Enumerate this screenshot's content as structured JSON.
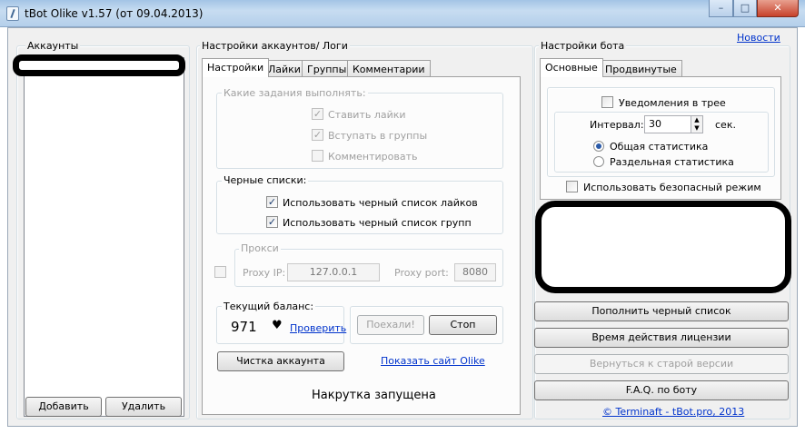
{
  "window": {
    "title": "tBot Olike v1.57 (от 09.04.2013)",
    "controls": {
      "minimize": "–",
      "maximize": "□",
      "close": "✕"
    }
  },
  "accounts": {
    "title": "Аккаунты",
    "add_button": "Добавить",
    "delete_button": "Удалить"
  },
  "settings_logs": {
    "title": "Настройки аккаунтов/ Логи",
    "tabs": [
      "Настройки",
      "Лайки",
      "Группы",
      "Комментарии"
    ],
    "tasks_group": {
      "title": "Какие задания выполнять:",
      "items": [
        {
          "label": "Ставить лайки",
          "checked": "✓"
        },
        {
          "label": "Вступать в группы",
          "checked": "✓"
        },
        {
          "label": "Комментировать",
          "checked": ""
        }
      ]
    },
    "blacklists_group": {
      "title": "Черные списки:",
      "items": [
        {
          "label": "Использовать черный список лайков",
          "checked": "✓"
        },
        {
          "label": "Использовать черный список групп",
          "checked": "✓"
        }
      ]
    },
    "proxy_group": {
      "title": "Прокси",
      "ip_label": "Proxy IP:",
      "ip_value": "127.0.0.1",
      "port_label": "Proxy port:",
      "port_value": "8080"
    },
    "balance_group": {
      "title": "Текущий баланс:",
      "value": "971",
      "heart": "♥",
      "check_link": "Проверить"
    },
    "start_button": "Поехали!",
    "stop_button": "Стоп",
    "clean_button": "Чистка аккаунта",
    "site_link": "Показать сайт Olike",
    "status": "Накрутка запущена"
  },
  "bot_settings": {
    "title": "Настройки бота",
    "news_link": "Новости",
    "tabs": [
      "Основные",
      "Продвинутые"
    ],
    "tray_notify": "Уведомления в трее",
    "interval_label": "Интервал:",
    "interval_value": "30",
    "interval_unit": "сек.",
    "radio_common": "Общая статистика",
    "radio_separate": "Раздельная статистика",
    "safe_mode": "Использовать безопасный режим",
    "buttons": {
      "fill_blacklist": "Пополнить черный список",
      "license": "Время действия лицензии",
      "old_version": "Вернуться к старой версии",
      "faq": "F.A.Q. по боту"
    },
    "copyright": "© Terminaft - tBot.pro, 2013"
  }
}
